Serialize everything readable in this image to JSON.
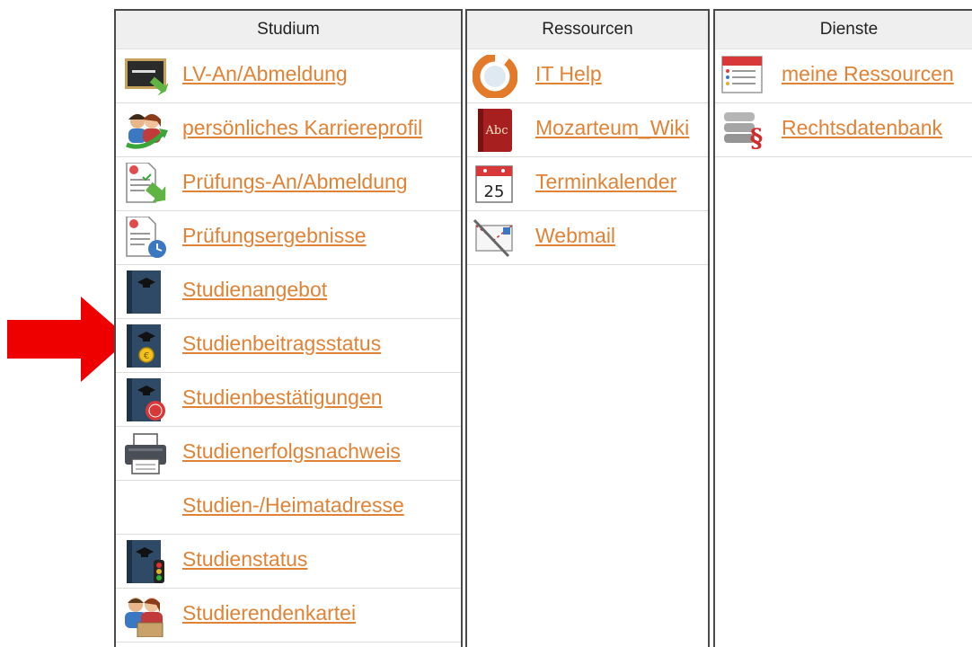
{
  "studium": {
    "header": "Studium",
    "items": [
      {
        "label": "LV-An/Abmeldung",
        "icon": "lv-registration-icon"
      },
      {
        "label": "persönliches Karriereprofil",
        "icon": "career-profile-icon"
      },
      {
        "label": "Prüfungs-An/Abmeldung",
        "icon": "exam-registration-icon"
      },
      {
        "label": "Prüfungsergebnisse",
        "icon": "exam-results-icon"
      },
      {
        "label": "Studienangebot",
        "icon": "study-offer-book-icon"
      },
      {
        "label": "Studienbeitragsstatus",
        "icon": "tuition-fee-book-icon"
      },
      {
        "label": "Studienbestätigungen",
        "icon": "study-confirmation-book-icon"
      },
      {
        "label": "Studienerfolgsnachweis",
        "icon": "printer-icon"
      },
      {
        "label": "Studien-/Heimatadresse",
        "icon": ""
      },
      {
        "label": "Studienstatus",
        "icon": "study-status-traffic-light-icon"
      },
      {
        "label": "Studierendenkartei",
        "icon": "student-records-icon"
      }
    ]
  },
  "ressourcen": {
    "header": "Ressourcen",
    "items": [
      {
        "label": "IT Help",
        "icon": "lifebuoy-icon"
      },
      {
        "label": "Mozarteum_Wiki",
        "icon": "dictionary-book-icon"
      },
      {
        "label": "Terminkalender",
        "icon": "calendar-icon",
        "calendar_day": "25"
      },
      {
        "label": "Webmail",
        "icon": "mail-pen-icon"
      }
    ]
  },
  "dienste": {
    "header": "Dienste",
    "items": [
      {
        "label": "meine Ressourcen",
        "icon": "resource-list-icon"
      },
      {
        "label": "Rechtsdatenbank",
        "icon": "legal-database-icon"
      }
    ]
  },
  "annotation": {
    "icon": "red-arrow-icon",
    "color": "#ee0000"
  },
  "colors": {
    "link": "#e08336",
    "header_bg": "#efefef",
    "border": "#4a4a4a"
  }
}
